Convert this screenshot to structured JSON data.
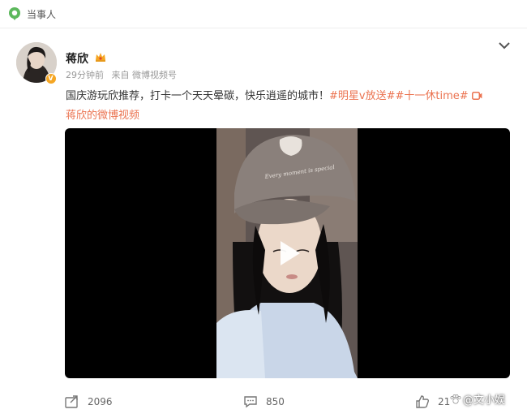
{
  "header": {
    "label": "当事人"
  },
  "post": {
    "username": "蒋欣",
    "time": "29分钟前",
    "source": "来自 微博视频号",
    "text": "国庆游玩欣推荐，打卡一个天天晕碳，快乐逍遥的城市！",
    "tag1": "#明星v放送#",
    "tag2": "#十一休time#",
    "video_link": "蒋欣的微博视频"
  },
  "video": {
    "cap_text": "Every moment is special"
  },
  "actions": {
    "repost_count": "2096",
    "comment_count": "850",
    "like_count": "21"
  },
  "watermark": {
    "text": "@文小娱"
  },
  "colors": {
    "accent": "#eb7350",
    "badge": "#f5a623",
    "header_icon": "#5cb85c"
  }
}
